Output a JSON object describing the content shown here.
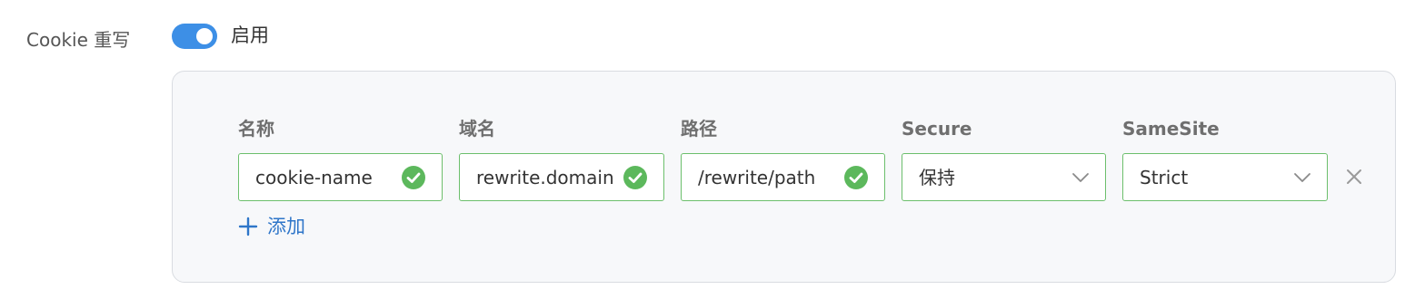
{
  "field": {
    "label": "Cookie 重写",
    "toggle_state": "on",
    "toggle_text": "启用"
  },
  "columns": {
    "name": "名称",
    "domain": "域名",
    "path": "路径",
    "secure": "Secure",
    "samesite": "SameSite"
  },
  "row": {
    "name": "cookie-name",
    "domain": "rewrite.domain",
    "path": "/rewrite/path",
    "secure": "保持",
    "samesite": "Strict"
  },
  "actions": {
    "add_label": "添加"
  },
  "colors": {
    "accent": "#3d8fe6",
    "valid_border": "#6cbf6c",
    "valid_icon": "#5cb85c",
    "link": "#2f76c9"
  },
  "icons": {
    "valid": "check-circle-icon",
    "dropdown": "chevron-down-icon",
    "remove": "close-icon",
    "add": "plus-icon"
  }
}
